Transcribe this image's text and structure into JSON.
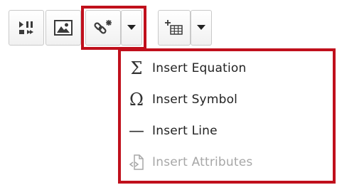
{
  "toolbar": {
    "buttons": [
      {
        "icon": "media-play-pause-icon"
      },
      {
        "icon": "image-icon"
      },
      {
        "icon": "link-icon"
      },
      {
        "icon": "chevron-down-icon"
      },
      {
        "icon": "table-insert-icon"
      },
      {
        "icon": "chevron-down-icon"
      }
    ]
  },
  "menu": {
    "items": [
      {
        "icon": "sigma-icon",
        "glyph": "Σ",
        "label": "Insert Equation",
        "enabled": true
      },
      {
        "icon": "omega-icon",
        "glyph": "Ω",
        "label": "Insert Symbol",
        "enabled": true
      },
      {
        "icon": "horizontal-line-icon",
        "glyph": "—",
        "label": "Insert Line",
        "enabled": true
      },
      {
        "icon": "attributes-icon",
        "glyph": "",
        "label": "Insert Attributes",
        "enabled": false
      }
    ]
  },
  "colors": {
    "highlight": "#c0101c",
    "disabled_text": "#a7a7a7"
  }
}
